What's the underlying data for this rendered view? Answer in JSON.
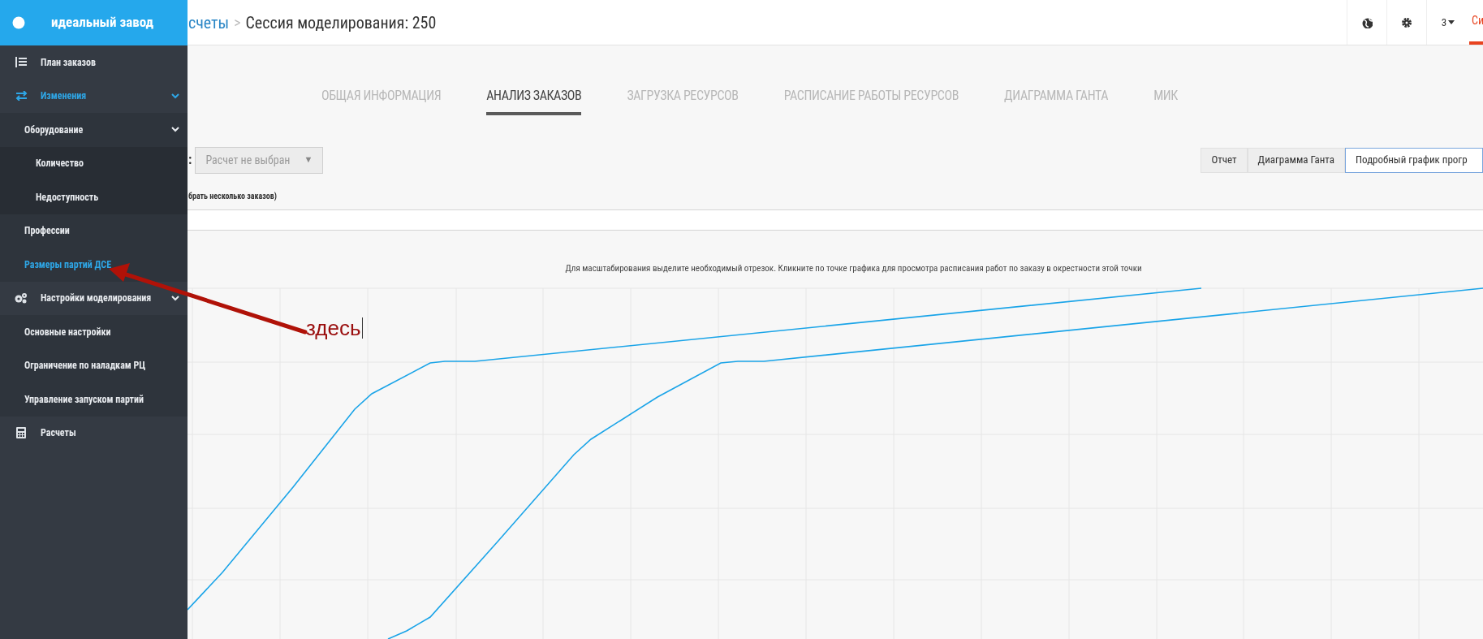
{
  "sidebar": {
    "brand": "идеальный завод",
    "items": [
      {
        "label": "План заказов",
        "selected": false
      },
      {
        "label": "Изменения",
        "selected": true,
        "expanded": true,
        "children": [
          {
            "label": "Оборудование",
            "selected": false,
            "expanded": true,
            "children": [
              {
                "label": "Количество",
                "selected": false
              },
              {
                "label": "Недоступность",
                "selected": false
              }
            ]
          },
          {
            "label": "Профессии",
            "selected": false
          },
          {
            "label": "Размеры партий ДСЕ",
            "selected": true
          }
        ]
      },
      {
        "label": "Настройки моделирования",
        "selected": false,
        "expanded": true,
        "children": [
          {
            "label": "Основные настройки",
            "selected": false
          },
          {
            "label": "Ограничение по наладкам РЦ",
            "selected": false
          },
          {
            "label": "Управление запуском партий",
            "selected": false
          }
        ]
      },
      {
        "label": "Расчеты",
        "selected": false
      }
    ]
  },
  "header": {
    "breadcrumb_link": "счеты",
    "breadcrumb_separator": ">",
    "title": "Сессия моделирования: 250",
    "user_menu": "3",
    "cut_tab": "Си"
  },
  "tabs": [
    {
      "label": "ОБЩАЯ ИНФОРМАЦИЯ",
      "selected": false
    },
    {
      "label": "АНАЛИЗ ЗАКАЗОВ",
      "selected": true
    },
    {
      "label": "ЗАГРУЗКА РЕСУРСОВ",
      "selected": false
    },
    {
      "label": "РАСПИСАНИЕ РАБОТЫ РЕСУРСОВ",
      "selected": false
    },
    {
      "label": "ДИАГРАММА ГАНТА",
      "selected": false
    },
    {
      "label": "МИК",
      "selected": false
    }
  ],
  "filter": {
    "label_tail": ":",
    "select_value": "Расчет не выбран",
    "select_arrow": "▼",
    "hint": "брать несколько заказов)"
  },
  "view_buttons": [
    {
      "label": "Отчет",
      "selected": false
    },
    {
      "label": "Диаграмма Ганта",
      "selected": false
    },
    {
      "label": "Подробный график прогр",
      "selected": true
    }
  ],
  "chart": {
    "caption": "Для масштабирования выделите необходимый отрезок. Кликните по точке графика для просмотра расписания работ по заказу в окрестности этой точки"
  },
  "annotation": {
    "text": "здесь"
  }
}
